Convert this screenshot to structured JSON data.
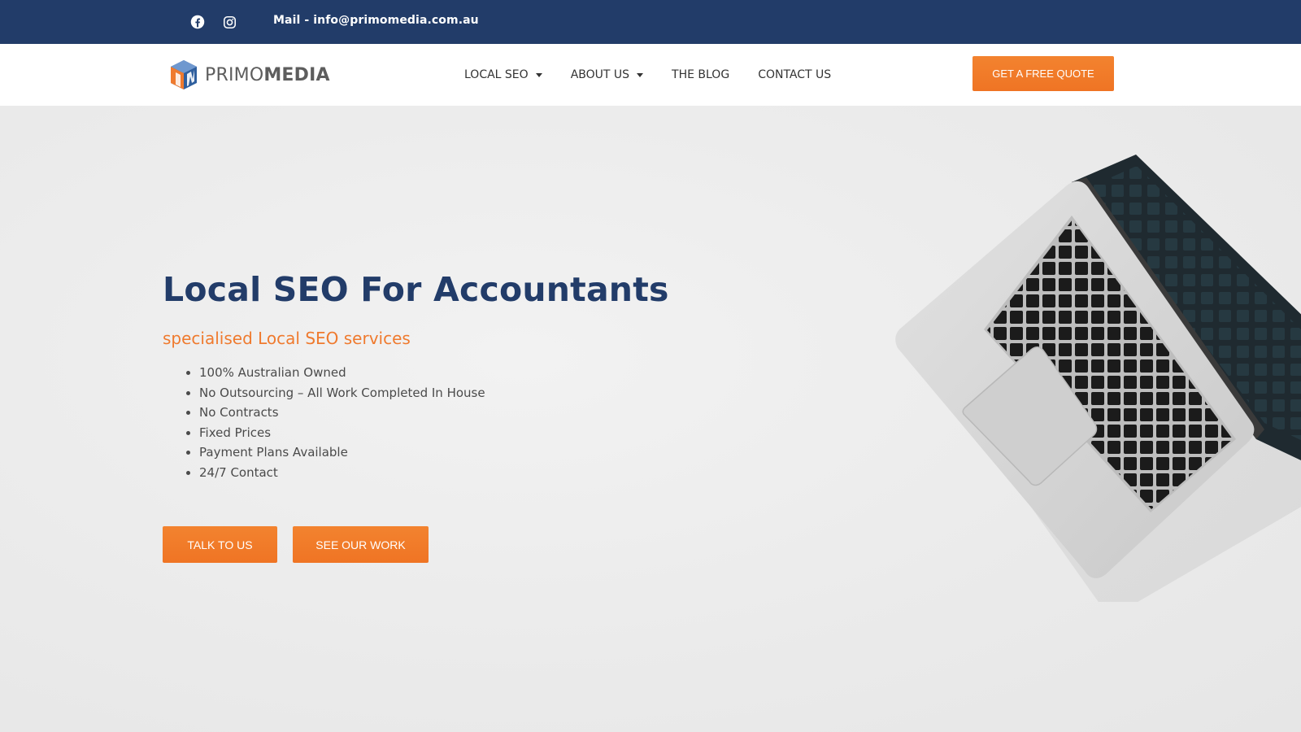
{
  "topbar": {
    "mail_text": "Mail - info@primomedia.com.au",
    "icons": [
      "facebook-icon",
      "instagram-icon"
    ]
  },
  "brand": {
    "logo_part1": "PRIMO",
    "logo_part2": "MEDIA"
  },
  "nav": {
    "items": [
      {
        "label": "LOCAL SEO",
        "has_dropdown": true
      },
      {
        "label": "ABOUT US",
        "has_dropdown": true
      },
      {
        "label": "THE BLOG",
        "has_dropdown": false
      },
      {
        "label": "CONTACT US",
        "has_dropdown": false
      }
    ],
    "cta_label": "GET A FREE QUOTE"
  },
  "hero": {
    "title": "Local SEO For Accountants",
    "subtitle": "specialised Local SEO services",
    "features": [
      "100% Australian Owned",
      "No Outsourcing – All Work Completed In House",
      "No Contracts",
      "Fixed Prices",
      "Payment Plans Available",
      "24/7 Contact"
    ],
    "buttons": {
      "talk": "TALK TO US",
      "work": "SEE OUR WORK"
    }
  },
  "colors": {
    "navy": "#223c69",
    "orange": "#ef7a2e",
    "hero_bg": "#ececec"
  }
}
